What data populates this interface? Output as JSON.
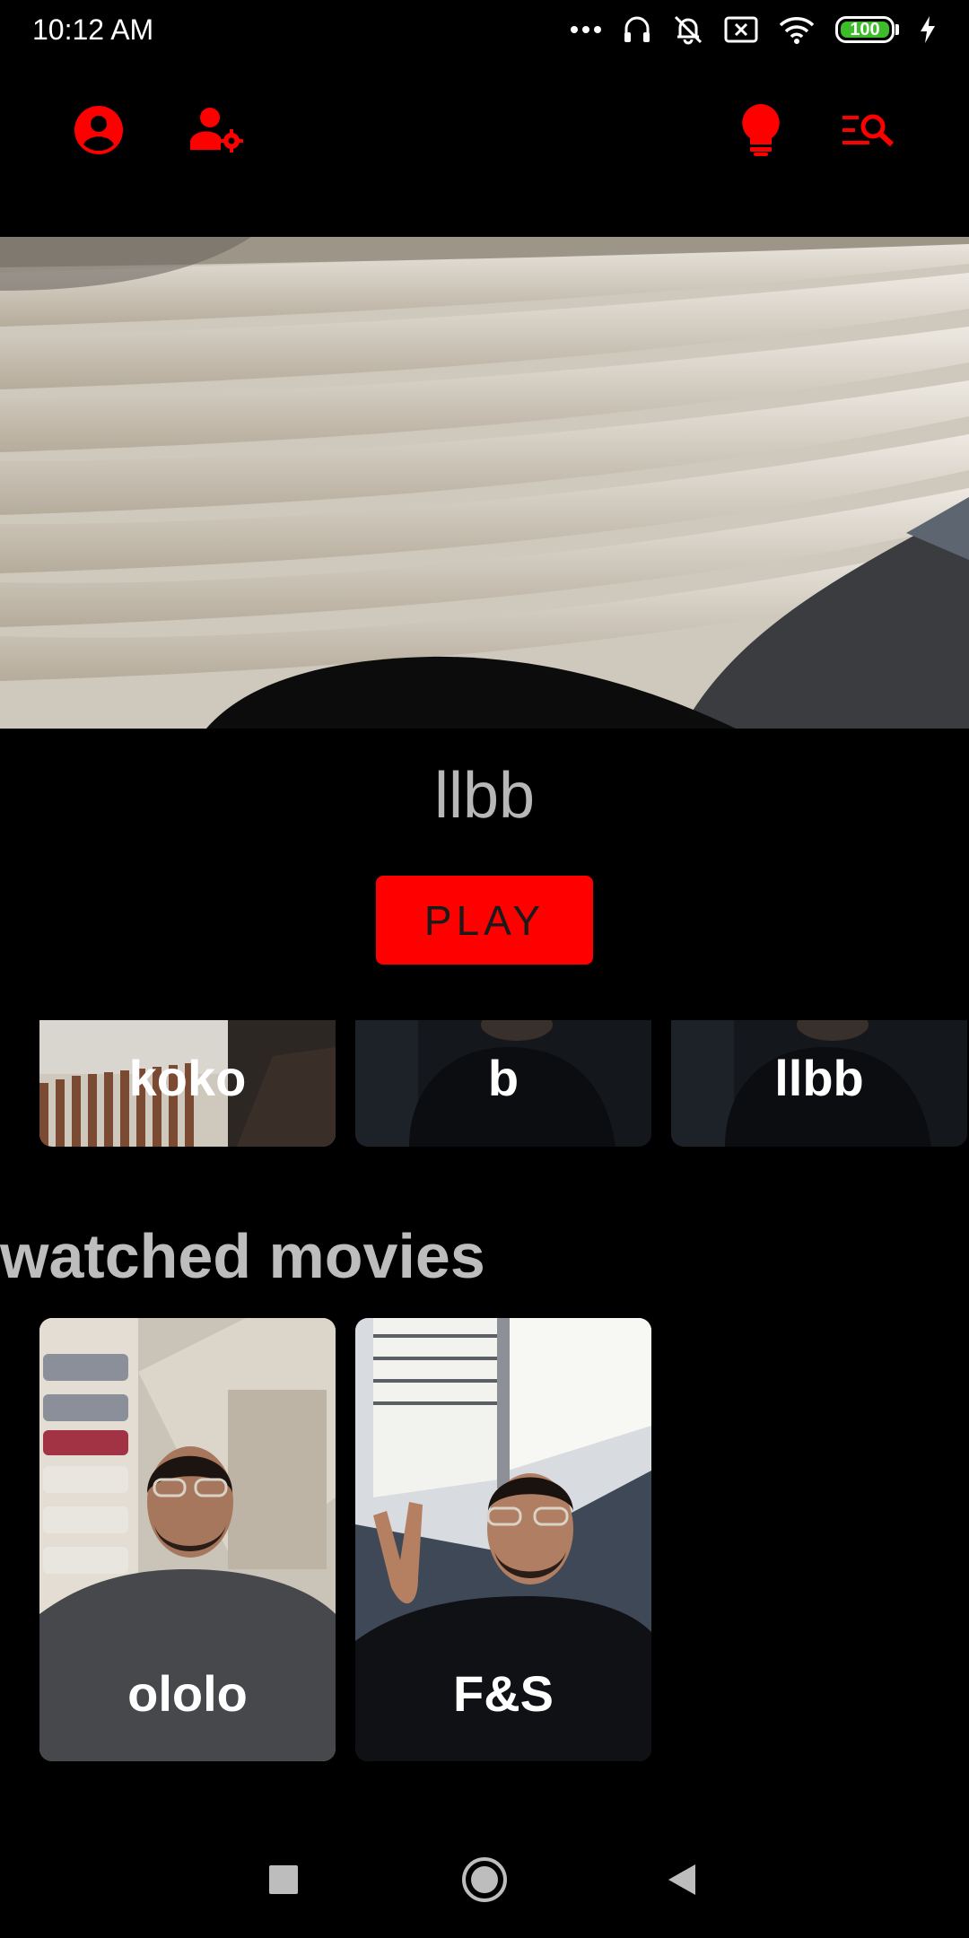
{
  "status_bar": {
    "time": "10:12 AM",
    "battery_level": "100",
    "icons": [
      "more-dots-icon",
      "headset-icon",
      "bell-off-icon",
      "close-box-icon",
      "wifi-icon",
      "battery-icon",
      "charging-bolt-icon"
    ]
  },
  "app_bar": {
    "left_icons": [
      "account-circle-icon",
      "manage-accounts-icon"
    ],
    "right_icons": [
      "lightbulb-icon",
      "search-list-icon"
    ],
    "accent_color": "#ff0000"
  },
  "hero": {
    "title": "llbb",
    "play_label": "PLAY"
  },
  "top_row": {
    "items": [
      {
        "label": "koko"
      },
      {
        "label": "b"
      },
      {
        "label": "llbb"
      }
    ]
  },
  "watched": {
    "title": "watched movies",
    "items": [
      {
        "label": "ololo"
      },
      {
        "label": "F&S"
      }
    ]
  },
  "nav_bar": {
    "icons": [
      "recents-square-icon",
      "home-circle-icon",
      "back-triangle-icon"
    ]
  }
}
